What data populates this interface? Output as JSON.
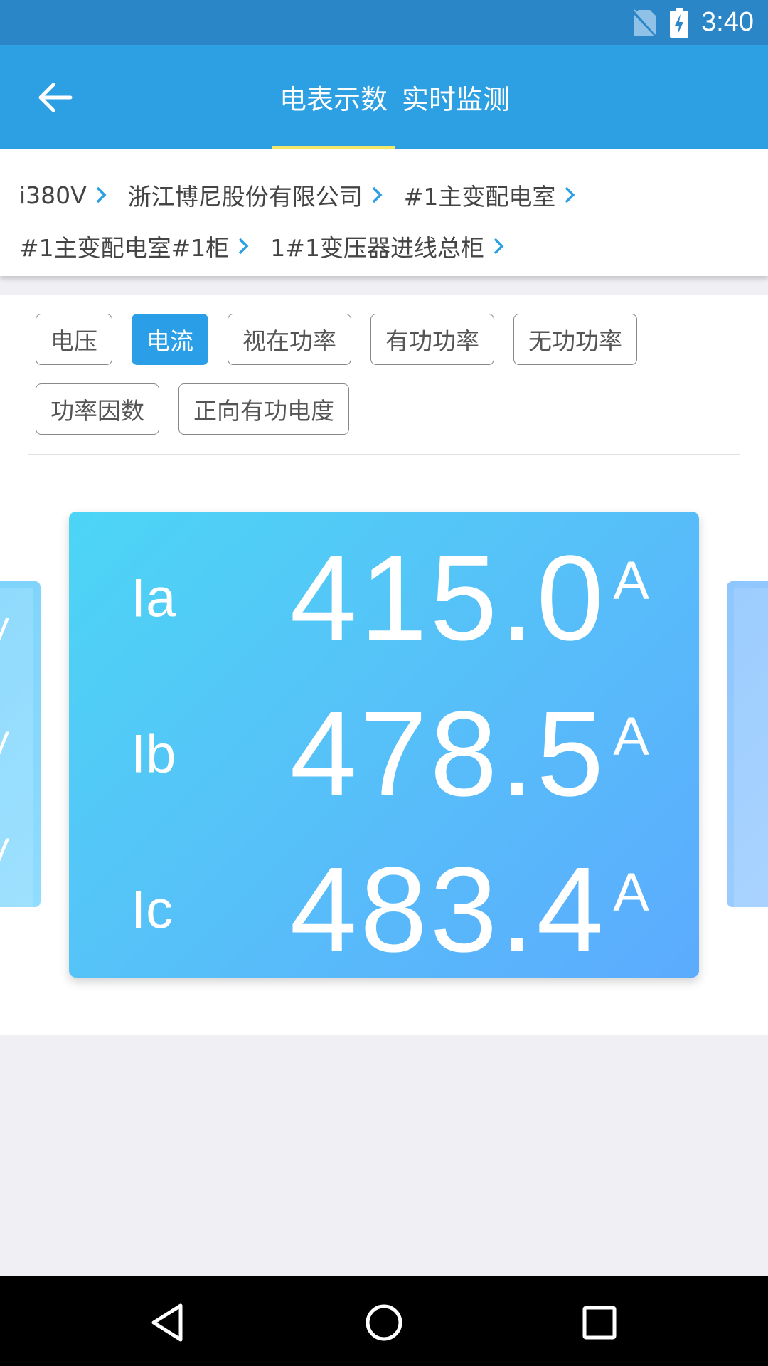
{
  "status_bar": {
    "time": "3:40"
  },
  "app_bar": {
    "tabs": [
      {
        "label": "电表示数",
        "active": true
      },
      {
        "label": "实时监测",
        "active": false
      }
    ]
  },
  "breadcrumb": {
    "rows": [
      [
        "i380V",
        "浙江博尼股份有限公司",
        "#1主变配电室"
      ],
      [
        "#1主变配电室#1柜",
        "1#1变压器进线总柜"
      ]
    ]
  },
  "chips": {
    "rows": [
      [
        "电压",
        "电流",
        "视在功率",
        "有功功率",
        "无功功率"
      ],
      [
        "功率因数",
        "正向有功电度"
      ]
    ],
    "selected": "电流"
  },
  "readings": [
    {
      "label": "Ia",
      "value": "415.0",
      "unit": "A"
    },
    {
      "label": "Ib",
      "value": "478.5",
      "unit": "A"
    },
    {
      "label": "Ic",
      "value": "483.4",
      "unit": "A"
    }
  ],
  "left_card_peek": [
    "V",
    "V",
    "V"
  ],
  "colors": {
    "status_bar": "#2a86c7",
    "app_bar": "#2d9fe3",
    "tab_indicator": "#f4e86b",
    "chip_active": "#2b9ee8",
    "card_gradient_start": "#4cd5f6",
    "card_gradient_end": "#5cabfe",
    "breadcrumb_chevron": "#2d9fe3"
  }
}
